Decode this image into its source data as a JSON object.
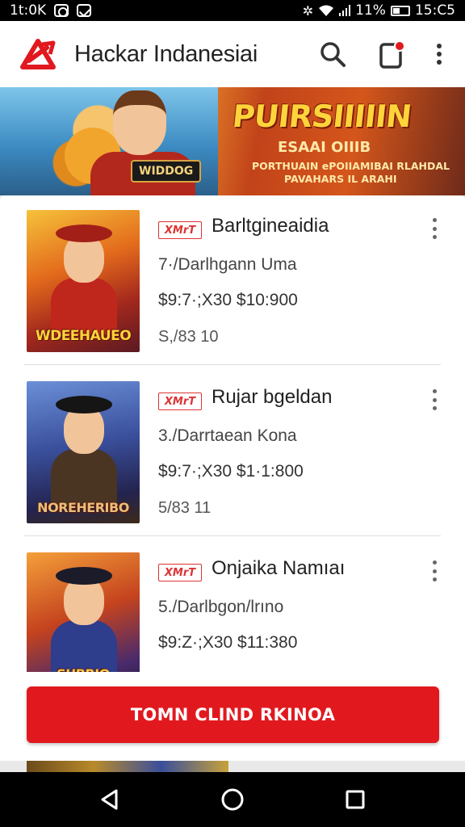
{
  "status_bar": {
    "time_left": "1t:0K",
    "signal_text": "11%",
    "time_right": "15:C5"
  },
  "app_bar": {
    "title": "Hackar Indanesiai",
    "icons": [
      "logo-icon",
      "search-icon",
      "notification-icon",
      "more-vert-icon"
    ],
    "accent_color": "#e1191f"
  },
  "banner": {
    "badge": "WIDDOG",
    "title": "PUIRSIIIIIN",
    "line1": "ESAAI OIIIB",
    "line2": "PORTHUAIN ePOIIAMIBAI RLAHDAL",
    "line3": "PAVAHARS IL ARAHI"
  },
  "items": [
    {
      "badge": "XMrT",
      "title": "Barltgineaidia",
      "meta": "7·/Darlhgann Uma",
      "price": "$9:7·;X30  $10:900",
      "count": "S,/83 10",
      "cover_label": "WDEEHAUEO"
    },
    {
      "badge": "XMrT",
      "title": "Rujar bgeldan",
      "meta": "3./Darrtaean Kona",
      "price": "$9:7·;X30  $1·1:800",
      "count": "5/83 11",
      "cover_label": "NOREHERIBO"
    },
    {
      "badge": "XMrT",
      "title": "Onjaika Namıaı",
      "meta": "5./Darlbgon/lrıno",
      "price": "$9:Z·;X30  $11:380",
      "count": "",
      "cover_label": "SUBRIO"
    }
  ],
  "cta": {
    "label": "TOMN CLIND RKINOA"
  },
  "nav_bar": {
    "icons": [
      "back-icon",
      "home-icon",
      "recents-icon"
    ]
  }
}
